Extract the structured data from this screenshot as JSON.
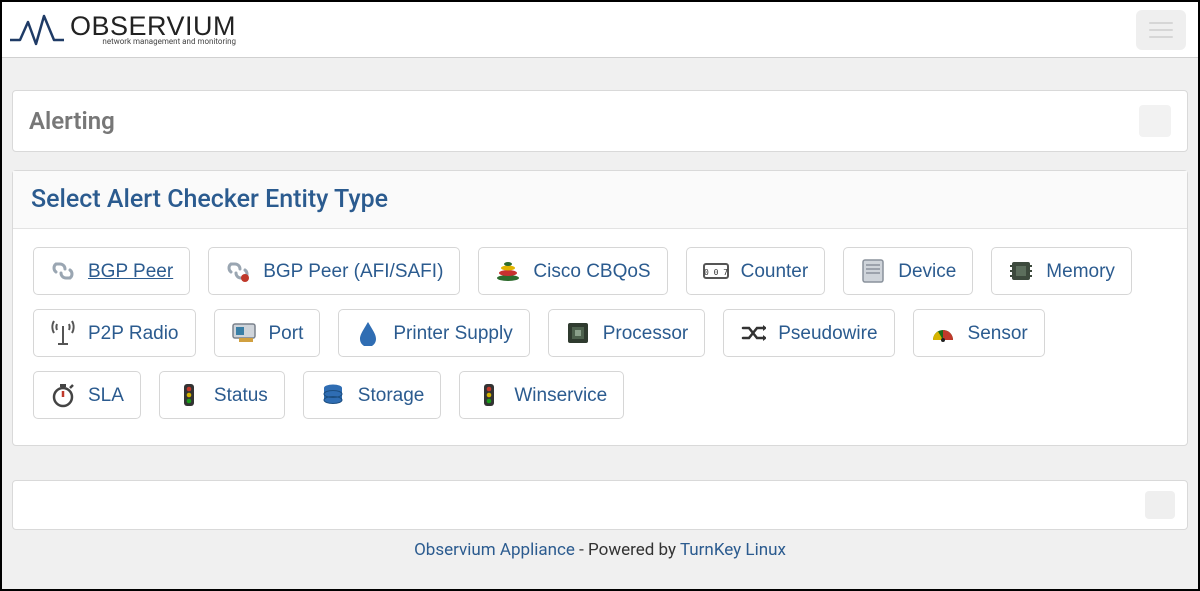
{
  "brand": {
    "name": "OBSERVIUM",
    "tagline": "network management and monitoring"
  },
  "alerting": {
    "title": "Alerting"
  },
  "selector": {
    "title": "Select Alert Checker Entity Type",
    "entities": [
      {
        "id": "bgp-peer",
        "label": " BGP Peer",
        "icon": "link-icon",
        "hover": true
      },
      {
        "id": "bgp-peer-afisafi",
        "label": "BGP Peer (AFI/SAFI)",
        "icon": "link-pin-icon",
        "hover": false
      },
      {
        "id": "cisco-cbqos",
        "label": "Cisco CBQoS",
        "icon": "stack-icon",
        "hover": false
      },
      {
        "id": "counter",
        "label": "Counter",
        "icon": "counter-icon",
        "hover": false
      },
      {
        "id": "device",
        "label": "Device",
        "icon": "server-icon",
        "hover": false
      },
      {
        "id": "memory",
        "label": "Memory",
        "icon": "chip-icon",
        "hover": false
      },
      {
        "id": "p2p-radio",
        "label": "P2P Radio",
        "icon": "antenna-icon",
        "hover": false
      },
      {
        "id": "port",
        "label": "Port",
        "icon": "nic-icon",
        "hover": false
      },
      {
        "id": "printer-supply",
        "label": "Printer Supply",
        "icon": "drop-icon",
        "hover": false
      },
      {
        "id": "processor",
        "label": "Processor",
        "icon": "cpu-icon",
        "hover": false
      },
      {
        "id": "pseudowire",
        "label": "Pseudowire",
        "icon": "shuffle-icon",
        "hover": false
      },
      {
        "id": "sensor",
        "label": "Sensor",
        "icon": "gauge-icon",
        "hover": false
      },
      {
        "id": "sla",
        "label": "SLA",
        "icon": "stopwatch-icon",
        "hover": false
      },
      {
        "id": "status",
        "label": "Status",
        "icon": "traffic-icon",
        "hover": false
      },
      {
        "id": "storage",
        "label": "Storage",
        "icon": "db-icon",
        "hover": false
      },
      {
        "id": "winservice",
        "label": "Winservice",
        "icon": "traffic-icon",
        "hover": false
      }
    ]
  },
  "footer": {
    "appliance": "Observium Appliance",
    "powered": " - Powered by ",
    "vendor": "TurnKey Linux"
  }
}
